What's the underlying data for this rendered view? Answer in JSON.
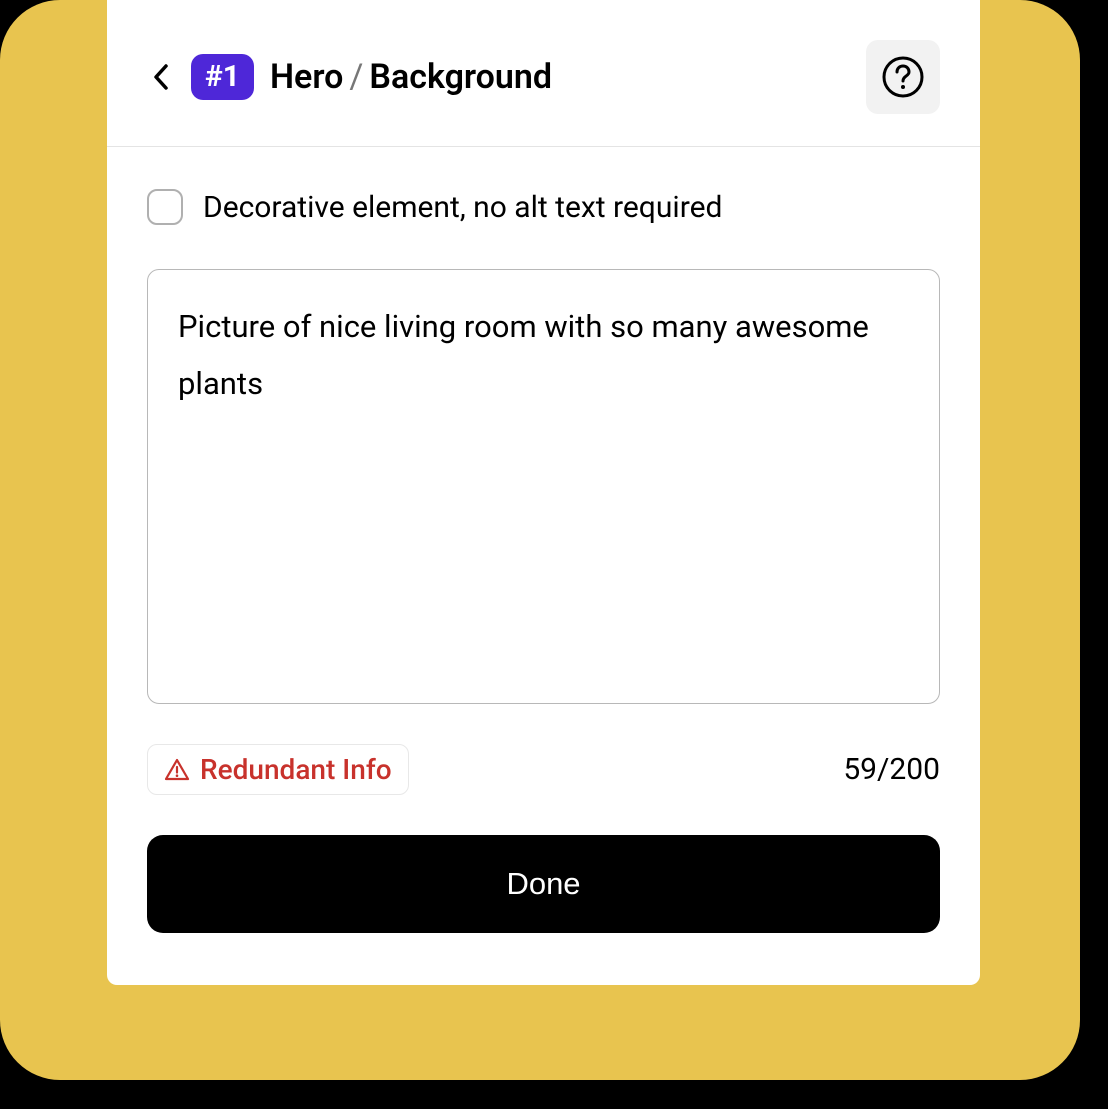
{
  "header": {
    "badge": "#1",
    "breadcrumb": {
      "part1": "Hero",
      "separator": "/",
      "part2": "Background"
    }
  },
  "form": {
    "decorative_checkbox_label": "Decorative element, no alt text required",
    "alt_text_value": "Picture of nice living room with so many awesome plants",
    "warning_label": "Redundant Info",
    "char_count": "59/200",
    "done_button_label": "Done"
  },
  "colors": {
    "badge_bg": "#4e27d8",
    "warning_text": "#c8322c",
    "outer_bg": "#e8c44f"
  }
}
